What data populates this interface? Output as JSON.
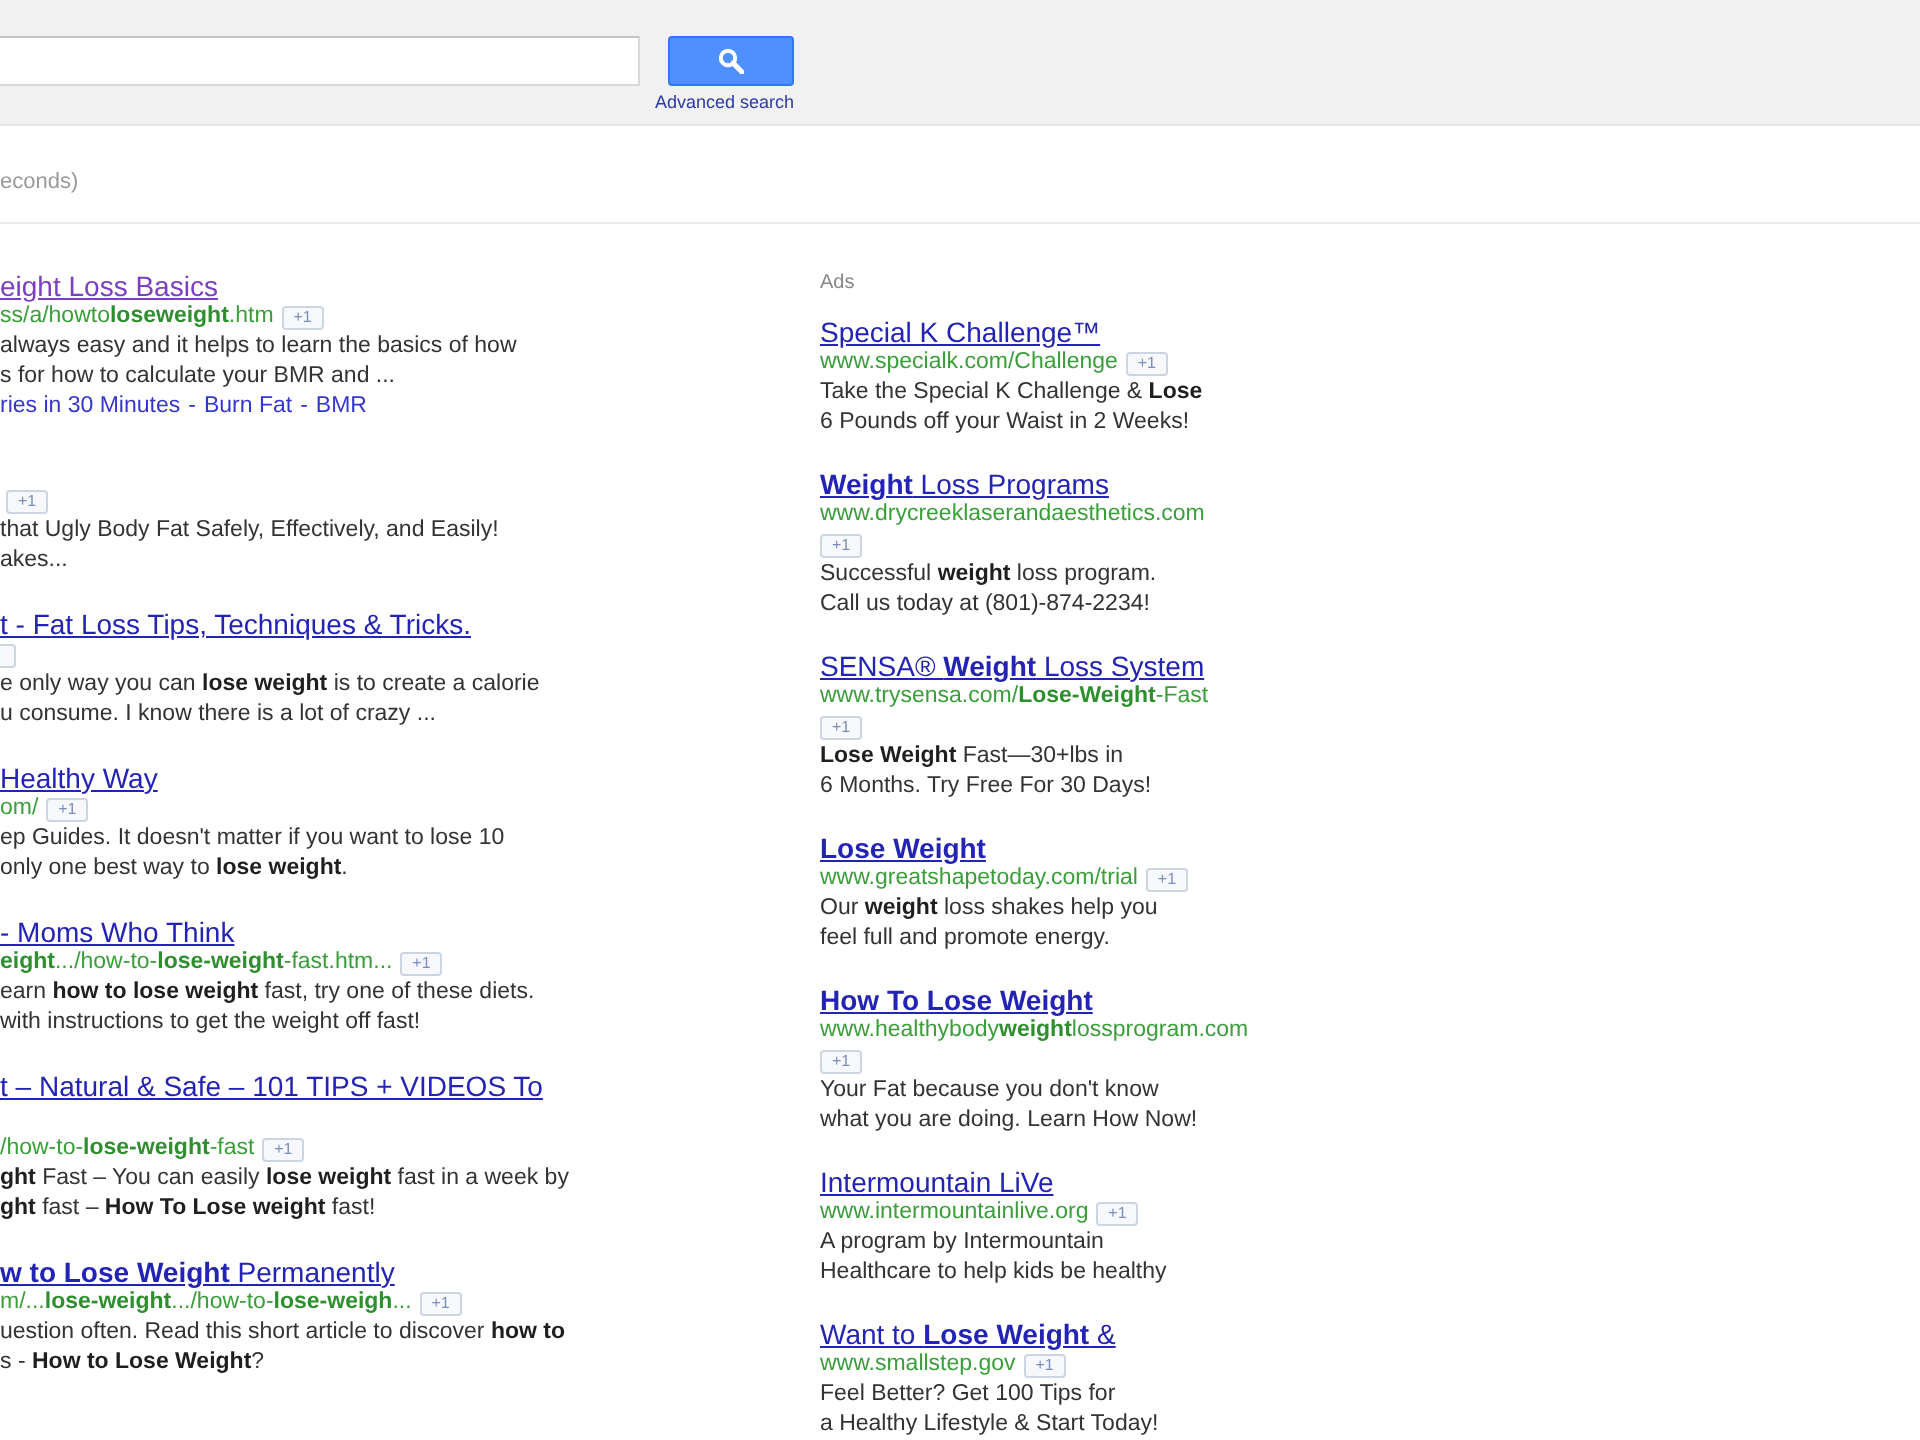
{
  "search": {
    "advanced_link": "Advanced search"
  },
  "stats": "econds)",
  "results": [
    {
      "title": "eight Loss Basics",
      "visited": true,
      "url": "ss/a/howto**loseweight**.htm",
      "plus_one": "+1",
      "snippet": [
        "always easy and it helps to learn the basics of how",
        "s for how to calculate your BMR and ..."
      ],
      "sitelinks": [
        "ries in 30 Minutes",
        "Burn Fat",
        "BMR"
      ],
      "sitelink_separators": [
        "-",
        "-"
      ]
    },
    {
      "plus_one": "+1",
      "snippet": [
        "that Ugly Body Fat Safely, Effectively, and Easily!",
        "akes..."
      ]
    },
    {
      "title": "t - Fat Loss Tips, Techniques & Tricks.",
      "visited": false,
      "plus_one_edge": true,
      "snippet": [
        "e only way you can **lose weight** is to create a calorie",
        "u consume. I know there is a lot of crazy ..."
      ]
    },
    {
      "title": "Healthy Way",
      "visited": false,
      "url": "om/",
      "plus_one": "+1",
      "snippet": [
        "ep Guides. It doesn't matter if you want to lose 10",
        "only one best way to **lose weight**."
      ]
    },
    {
      "title": "- Moms Who Think",
      "visited": false,
      "url": "**eight**.../how-to-**lose-weight**-fast.htm...",
      "plus_one": "+1",
      "snippet": [
        "earn **how to lose weight** fast, try one of these diets.",
        "with instructions to get the weight off fast!"
      ]
    },
    {
      "title": "t – Natural & Safe – 101 TIPS + VIDEOS To",
      "visited": false,
      "title_wraps": true,
      "url": "/how-to-**lose-weight**-fast",
      "plus_one": "+1",
      "snippet": [
        "**ght** Fast – You can easily **lose weight** fast in a week by",
        "**ght** fast – **How To Lose weight** fast!"
      ]
    },
    {
      "title": "**w to Lose Weight** Permanently",
      "visited": false,
      "url": "m/...**lose-weight**.../how-to-**lose-weigh**...",
      "plus_one": "+1",
      "snippet": [
        "uestion often. Read this short article to discover **how to**",
        "s - **How to Lose Weight**?"
      ]
    }
  ],
  "ads": {
    "label": "Ads",
    "items": [
      {
        "title": "Special K Challenge™",
        "bold": false,
        "url": "www.specialk.com/Challenge",
        "plus_one": "+1",
        "snippet": [
          "Take the Special K Challenge & **Lose**",
          "6 Pounds off your Waist in 2 Weeks!"
        ]
      },
      {
        "title": "**Weight** Loss Programs",
        "bold": false,
        "url": "www.drycreeklaserandaesthetics.com",
        "plus_one": "+1",
        "snippet": [
          "Successful **weight** loss program.",
          "Call us today at (801)-874-2234!"
        ]
      },
      {
        "title": "SENSA® **Weight** Loss System",
        "bold": false,
        "url": "www.trysensa.com/**Lose-Weight**-Fast",
        "plus_one": "+1",
        "snippet": [
          "**Lose Weight** Fast—30+lbs in",
          "6 Months. Try Free For 30 Days!"
        ]
      },
      {
        "title": "Lose Weight",
        "bold": true,
        "url": "www.greatshapetoday.com/trial",
        "plus_one": "+1",
        "snippet": [
          "Our **weight** loss shakes help you",
          "feel full and promote energy."
        ]
      },
      {
        "title": "How To Lose Weight",
        "bold": true,
        "url": "www.healthybody**weight**lossprogram.com",
        "plus_one": "+1",
        "snippet": [
          "Your Fat because you don't know",
          "what you are doing. Learn How Now!"
        ]
      },
      {
        "title": "Intermountain LiVe",
        "bold": false,
        "url": "www.intermountainlive.org",
        "plus_one": "+1",
        "snippet": [
          "A program by Intermountain",
          "Healthcare to help kids be healthy"
        ]
      },
      {
        "title": "Want to **Lose Weight** &",
        "bold": false,
        "url": "www.smallstep.gov",
        "plus_one": "+1",
        "snippet": [
          "Feel Better? Get 100 Tips for",
          "a Healthy Lifestyle & Start Today!"
        ]
      }
    ]
  }
}
